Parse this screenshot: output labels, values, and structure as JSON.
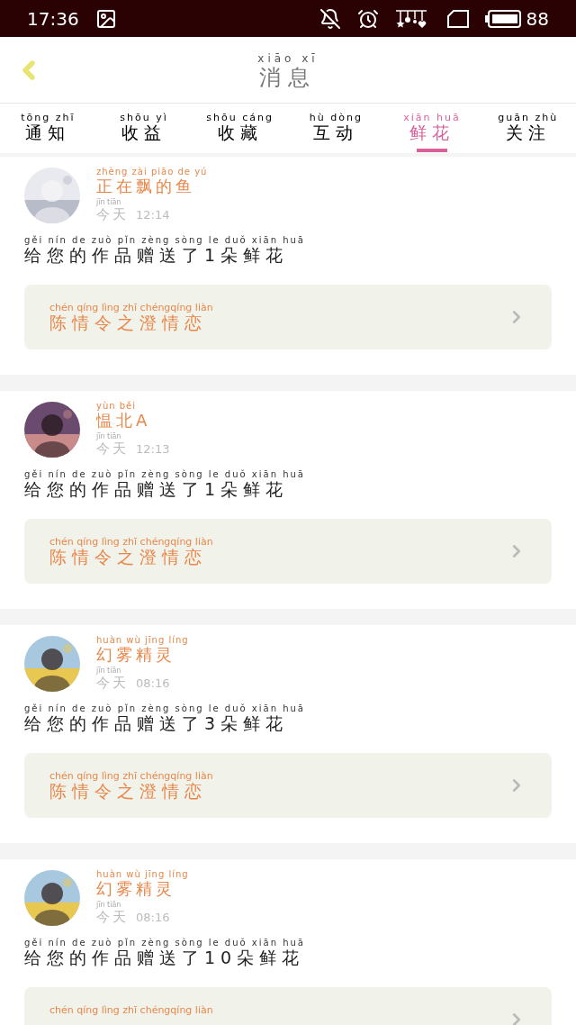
{
  "status_bar": {
    "time": "17:36",
    "battery": "88"
  },
  "header": {
    "title": "消息",
    "title_pinyin": "xiāo xī"
  },
  "tabs": [
    {
      "label": "通知",
      "pinyin": "tōng zhī",
      "selected": false
    },
    {
      "label": "收益",
      "pinyin": "shōu yì",
      "selected": false
    },
    {
      "label": "收藏",
      "pinyin": "shōu cáng",
      "selected": false
    },
    {
      "label": "互动",
      "pinyin": "hù dòng",
      "selected": false
    },
    {
      "label": "鲜花",
      "pinyin": "xiān huā",
      "selected": true
    },
    {
      "label": "关注",
      "pinyin": "guān zhù",
      "selected": false
    }
  ],
  "messages": [
    {
      "name": "正在飘的鱼",
      "name_pinyin": "zhèng zài piāo de yú",
      "day": "今天",
      "day_pinyin": "jīn tiān",
      "time": "12:14",
      "text": "给您的作品赠送了1朵鲜花",
      "text_pinyin": "gěi nín de zuò pǐn zèng sòng le duǒ xiān huā",
      "work": {
        "title": "陈情令之澄情恋",
        "pinyin": "chén qíng lìng zhī chéngqíng liàn"
      }
    },
    {
      "name": "愠北A",
      "name_pinyin": "yùn běi",
      "day": "今天",
      "day_pinyin": "jīn tiān",
      "time": "12:13",
      "text": "给您的作品赠送了1朵鲜花",
      "text_pinyin": "gěi nín de zuò pǐn zèng sòng le duǒ xiān huā",
      "work": {
        "title": "陈情令之澄情恋",
        "pinyin": "chén qíng lìng zhī chéngqíng liàn"
      }
    },
    {
      "name": "幻雾精灵",
      "name_pinyin": "huàn wù jīng líng",
      "day": "今天",
      "day_pinyin": "jīn tiān",
      "time": "08:16",
      "text": "给您的作品赠送了3朵鲜花",
      "text_pinyin": "gěi nín de zuò pǐn zèng sòng le duǒ xiān huā",
      "work": {
        "title": "陈情令之澄情恋",
        "pinyin": "chén qíng lìng zhī chéngqíng liàn"
      }
    },
    {
      "name": "幻雾精灵",
      "name_pinyin": "huàn wù jīng líng",
      "day": "今天",
      "day_pinyin": "jīn tiān",
      "time": "08:16",
      "text": "给您的作品赠送了10朵鲜花",
      "text_pinyin": "gěi nín de zuò pǐn zèng sòng le duǒ xiān huā",
      "work": {
        "pinyin": "chén qíng lìng zhī chéngqíng liàn"
      }
    }
  ]
}
